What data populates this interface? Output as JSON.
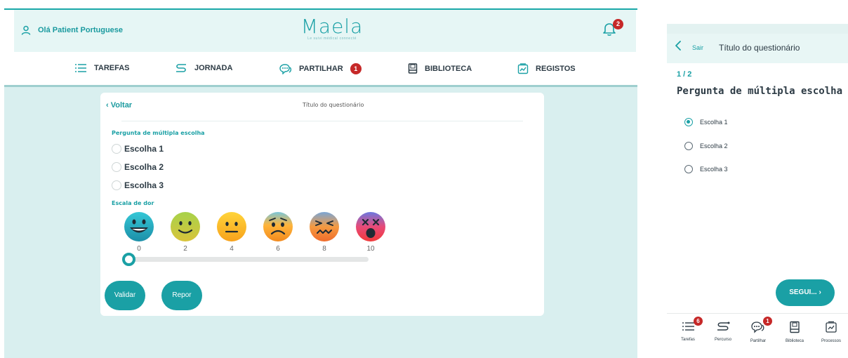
{
  "desktop": {
    "greeting": "Olá Patient Portuguese",
    "logo": {
      "word": "Maela",
      "tagline": "Le suivi médical connecté"
    },
    "notifications_count": "2",
    "nav": [
      {
        "label": "TAREFAS",
        "icon": "list-icon"
      },
      {
        "label": "JORNADA",
        "icon": "route-icon"
      },
      {
        "label": "PARTILHAR",
        "icon": "share-chat-icon",
        "badge": "1"
      },
      {
        "label": "BIBLIOTECA",
        "icon": "book-icon"
      },
      {
        "label": "REGISTOS",
        "icon": "chart-record-icon"
      }
    ],
    "form": {
      "back_label": "Voltar",
      "title": "Título do questionário",
      "question_label": "Pergunta de múltipla escolha",
      "options": [
        "Escolha 1",
        "Escolha 2",
        "Escolha 3"
      ],
      "scale_label": "Escala de dor",
      "scale_values": [
        "0",
        "2",
        "4",
        "6",
        "8",
        "10"
      ],
      "slider_value": 0,
      "validate_label": "Validar",
      "reset_label": "Repor"
    },
    "colors": {
      "accent": "#1aa0a5",
      "badge": "#c62828",
      "background": "#d9efef"
    }
  },
  "mobile": {
    "exit_label": "Sair",
    "title": "Título do questionário",
    "step": "1 / 2",
    "question": "Pergunta de múltipla escolha",
    "options": [
      "Escolha 1",
      "Escolha 2",
      "Escolha 3"
    ],
    "selected_option_index": 0,
    "next_label": "SEGUI...",
    "tabs": [
      {
        "label": "Tarefas",
        "icon": "list-icon",
        "badge": "6"
      },
      {
        "label": "Percurso",
        "icon": "route-icon"
      },
      {
        "label": "Partilhar",
        "icon": "share-chat-icon",
        "badge": "1"
      },
      {
        "label": "Biblioteca",
        "icon": "book-icon"
      },
      {
        "label": "Processos",
        "icon": "chart-record-icon"
      }
    ]
  }
}
